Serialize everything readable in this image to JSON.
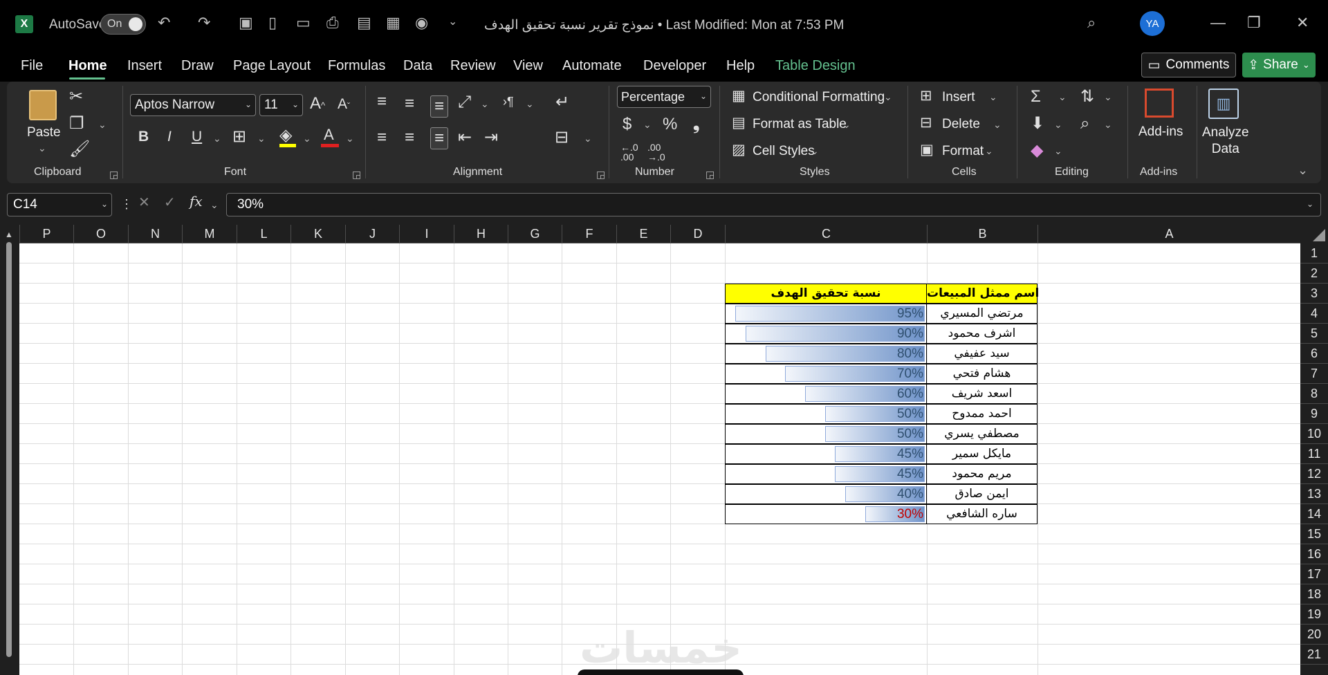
{
  "titlebar": {
    "autosave_label": "AutoSave",
    "toggle_label": "On",
    "doc_title": "نموذج تقرير نسبة تحقيق الهدف • Last Modified: Mon at 7:53 PM",
    "user_initials": "YA"
  },
  "menu": {
    "file": "File",
    "home": "Home",
    "insert": "Insert",
    "draw": "Draw",
    "page_layout": "Page Layout",
    "formulas": "Formulas",
    "data": "Data",
    "review": "Review",
    "view": "View",
    "automate": "Automate",
    "developer": "Developer",
    "help": "Help",
    "table_design": "Table Design",
    "comments": "Comments",
    "share": "Share"
  },
  "ribbon": {
    "paste": "Paste",
    "font_name": "Aptos Narrow",
    "font_size": "11",
    "number_format": "Percentage",
    "conditional_formatting": "Conditional Formatting",
    "format_as_table": "Format as Table",
    "cell_styles": "Cell Styles",
    "insert": "Insert",
    "delete": "Delete",
    "format": "Format",
    "addins": "Add-ins",
    "analyze_data_1": "Analyze",
    "analyze_data_2": "Data",
    "groups": {
      "clipboard": "Clipboard",
      "font": "Font",
      "alignment": "Alignment",
      "number": "Number",
      "styles": "Styles",
      "cells": "Cells",
      "editing": "Editing",
      "addins": "Add-ins"
    }
  },
  "formula_bar": {
    "name_box": "C14",
    "formula": "30%"
  },
  "columns": [
    "P",
    "O",
    "N",
    "M",
    "L",
    "K",
    "J",
    "I",
    "H",
    "G",
    "F",
    "E",
    "D",
    "C",
    "B",
    "A"
  ],
  "rows": [
    "1",
    "2",
    "3",
    "4",
    "5",
    "6",
    "7",
    "8",
    "9",
    "10",
    "11",
    "12",
    "13",
    "14",
    "15",
    "16",
    "17",
    "18",
    "19",
    "20",
    "21"
  ],
  "table": {
    "header_name": "اسم ممثل المبيعات",
    "header_pct": "نسبة تحقيق الهدف",
    "rows": [
      {
        "name": "مرتضي المسيري",
        "pct": "95%",
        "value": 0.95
      },
      {
        "name": "اشرف محمود",
        "pct": "90%",
        "value": 0.9
      },
      {
        "name": "سيد عفيفي",
        "pct": "80%",
        "value": 0.8
      },
      {
        "name": "هشام فتحي",
        "pct": "70%",
        "value": 0.7
      },
      {
        "name": "اسعد شريف",
        "pct": "60%",
        "value": 0.6
      },
      {
        "name": "احمد ممدوح",
        "pct": "50%",
        "value": 0.5
      },
      {
        "name": "مصطفي يسري",
        "pct": "50%",
        "value": 0.5
      },
      {
        "name": "مايكل سمير",
        "pct": "45%",
        "value": 0.45
      },
      {
        "name": "مريم محمود",
        "pct": "45%",
        "value": 0.45
      },
      {
        "name": "ايمن  صادق",
        "pct": "40%",
        "value": 0.4
      },
      {
        "name": "ساره الشافعي",
        "pct": "30%",
        "value": 0.3
      }
    ]
  },
  "watermark": "خمسات",
  "colors": {
    "header_fill": "#ffff00",
    "bar": "#6f93c9",
    "low_value": "#c00000",
    "accent": "#64c18f"
  }
}
